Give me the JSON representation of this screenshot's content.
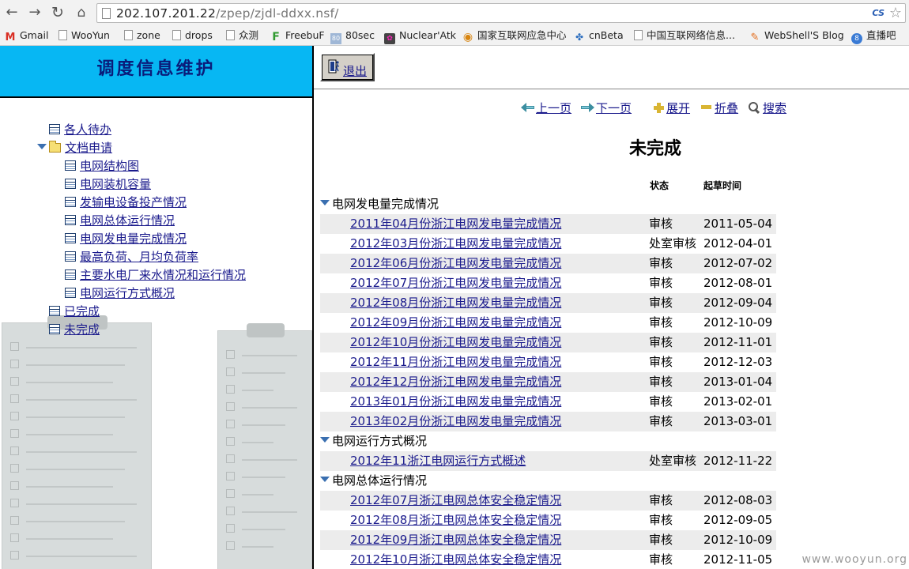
{
  "browser": {
    "url_host": "202.107.201.22",
    "url_path": "/zpep/zjdl-ddxx.nsf/",
    "extension_badge": "CS",
    "bookmarks": [
      {
        "label": "Gmail",
        "icon": "gmail-icon",
        "glyph": "M"
      },
      {
        "label": "WooYun",
        "icon": "page-icon",
        "glyph": ""
      },
      {
        "label": "zone",
        "icon": "page-icon",
        "glyph": ""
      },
      {
        "label": "drops",
        "icon": "page-icon",
        "glyph": ""
      },
      {
        "label": "众测",
        "icon": "page-icon",
        "glyph": ""
      },
      {
        "label": "FreebuF",
        "icon": "freebuf-icon",
        "glyph": "F"
      },
      {
        "label": "80sec",
        "icon": "80sec-icon",
        "glyph": "80"
      },
      {
        "label": "Nuclear'Atk",
        "icon": "nuclear-icon",
        "glyph": "✿"
      },
      {
        "label": "国家互联网应急中心",
        "icon": "cert-icon",
        "glyph": "◉"
      },
      {
        "label": "cnBeta",
        "icon": "cnbeta-icon",
        "glyph": "✤"
      },
      {
        "label": "中国互联网络信息...",
        "icon": "page-icon",
        "glyph": ""
      },
      {
        "label": "WebShell'S Blog",
        "icon": "webshell-icon",
        "glyph": "✎"
      },
      {
        "label": "直播吧",
        "icon": "zhibo-icon",
        "glyph": "8"
      }
    ]
  },
  "left": {
    "title": "调度信息维护",
    "tree": [
      {
        "label": "各人待办",
        "type": "doc",
        "level": 0
      },
      {
        "label": "文档申请",
        "type": "folder",
        "level": 0,
        "expanded": true
      },
      {
        "label": "电网结构图",
        "type": "doc",
        "level": 1
      },
      {
        "label": "电网装机容量",
        "type": "doc",
        "level": 1
      },
      {
        "label": "发输电设备投产情况",
        "type": "doc",
        "level": 1
      },
      {
        "label": "电网总体运行情况",
        "type": "doc",
        "level": 1
      },
      {
        "label": "电网发电量完成情况",
        "type": "doc",
        "level": 1
      },
      {
        "label": "最高负荷、月均负荷率",
        "type": "doc",
        "level": 1
      },
      {
        "label": "主要水电厂来水情况和运行情况",
        "type": "doc",
        "level": 1
      },
      {
        "label": "电网运行方式概况",
        "type": "doc",
        "level": 1
      },
      {
        "label": "已完成",
        "type": "doc",
        "level": 0
      },
      {
        "label": "未完成",
        "type": "doc",
        "level": 0
      }
    ]
  },
  "right": {
    "logout_label": "退出",
    "actions": {
      "prev": "上一页",
      "next": "下一页",
      "expand": "展开",
      "collapse": "折叠",
      "search": "搜索"
    },
    "view_title": "未完成",
    "columns": {
      "status": "状态",
      "date": "起草时间"
    },
    "categories": [
      {
        "name": "电网发电量完成情况",
        "rows": [
          {
            "title": "2011年04月份浙江电网发电量完成情况",
            "status": "审核",
            "date": "2011-05-04"
          },
          {
            "title": "2012年03月份浙江电网发电量完成情况",
            "status": "处室审核",
            "date": "2012-04-01"
          },
          {
            "title": "2012年06月份浙江电网发电量完成情况",
            "status": "审核",
            "date": "2012-07-02"
          },
          {
            "title": "2012年07月份浙江电网发电量完成情况",
            "status": "审核",
            "date": "2012-08-01"
          },
          {
            "title": "2012年08月份浙江电网发电量完成情况",
            "status": "审核",
            "date": "2012-09-04"
          },
          {
            "title": "2012年09月份浙江电网发电量完成情况",
            "status": "审核",
            "date": "2012-10-09"
          },
          {
            "title": "2012年10月份浙江电网发电量完成情况",
            "status": "审核",
            "date": "2012-11-01"
          },
          {
            "title": "2012年11月份浙江电网发电量完成情况",
            "status": "审核",
            "date": "2012-12-03"
          },
          {
            "title": "2012年12月份浙江电网发电量完成情况",
            "status": "审核",
            "date": "2013-01-04"
          },
          {
            "title": "2013年01月份浙江电网发电量完成情况",
            "status": "审核",
            "date": "2013-02-01"
          },
          {
            "title": "2013年02月份浙江电网发电量完成情况",
            "status": "审核",
            "date": "2013-03-01"
          }
        ]
      },
      {
        "name": "电网运行方式概况",
        "rows": [
          {
            "title": "2012年11浙江电网运行方式概述",
            "status": "处室审核",
            "date": "2012-11-22"
          }
        ]
      },
      {
        "name": "电网总体运行情况",
        "rows": [
          {
            "title": "2012年07月浙江电网总体安全稳定情况",
            "status": "审核",
            "date": "2012-08-03"
          },
          {
            "title": "2012年08月浙江电网总体安全稳定情况",
            "status": "审核",
            "date": "2012-09-05"
          },
          {
            "title": "2012年09月浙江电网总体安全稳定情况",
            "status": "审核",
            "date": "2012-10-09"
          },
          {
            "title": "2012年10月浙江电网总体安全稳定情况",
            "status": "审核",
            "date": "2012-11-05"
          }
        ]
      }
    ]
  },
  "watermark": "www.wooyun.org",
  "colors": {
    "header_bg": "#07b7f3",
    "header_title": "#0a1c7a",
    "link": "#1a1a8c",
    "row_alt": "#ececec",
    "toggle": "#3a6fb0"
  }
}
